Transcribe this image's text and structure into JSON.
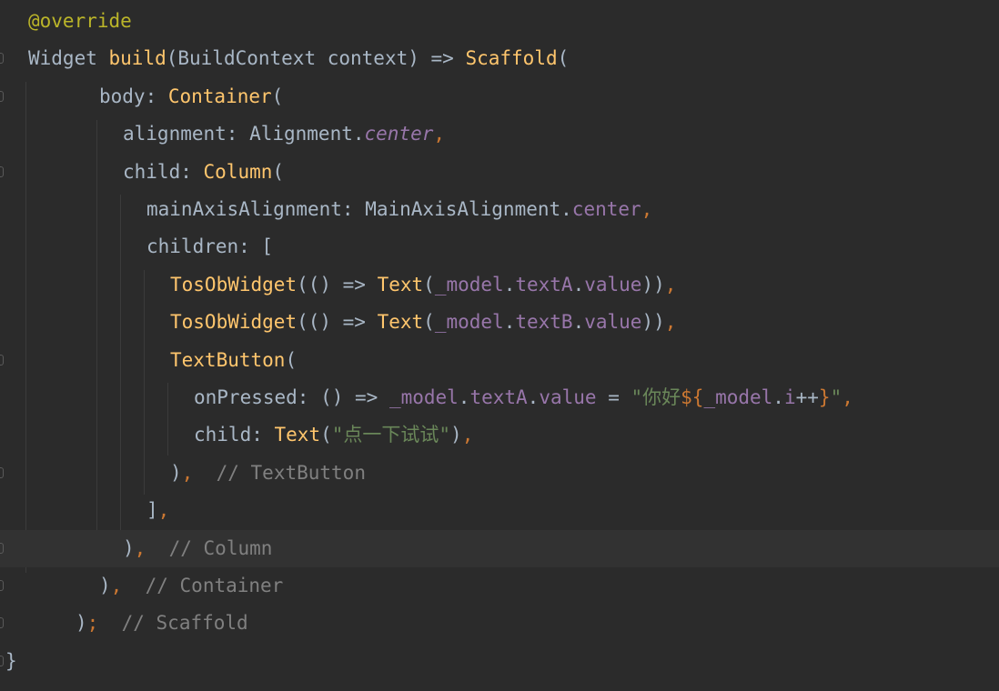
{
  "editor": {
    "language": "dart",
    "current_line": 14,
    "colors": {
      "background": "#2b2b2b",
      "current_line": "#323232",
      "annotation": "#bbb529",
      "plain": "#a9b7c6",
      "function": "#ffc66d",
      "keyword": "#cc7832",
      "field": "#9876aa",
      "string": "#6a8759",
      "comment": "#808080"
    },
    "lines": [
      {
        "fold": false,
        "tokens": [
          {
            "t": "@override",
            "c": "ann"
          }
        ]
      },
      {
        "fold": true,
        "tokens": [
          {
            "t": "Widget ",
            "c": "plain"
          },
          {
            "t": "build",
            "c": "fn"
          },
          {
            "t": "(BuildContext context) => ",
            "c": "plain"
          },
          {
            "t": "Scaffold",
            "c": "fn"
          },
          {
            "t": "(",
            "c": "plain"
          }
        ]
      },
      {
        "fold": true,
        "tokens": [
          {
            "t": "body: ",
            "c": "plain"
          },
          {
            "t": "Container",
            "c": "fn"
          },
          {
            "t": "(",
            "c": "plain"
          }
        ]
      },
      {
        "fold": false,
        "tokens": [
          {
            "t": "alignment: Alignment.",
            "c": "plain"
          },
          {
            "t": "center",
            "c": "static"
          },
          {
            "t": ",",
            "c": "kw"
          }
        ]
      },
      {
        "fold": true,
        "tokens": [
          {
            "t": "child: ",
            "c": "plain"
          },
          {
            "t": "Column",
            "c": "fn"
          },
          {
            "t": "(",
            "c": "plain"
          }
        ]
      },
      {
        "fold": false,
        "tokens": [
          {
            "t": "mainAxisAlignment: MainAxisAlignment.",
            "c": "plain"
          },
          {
            "t": "center",
            "c": "field"
          },
          {
            "t": ",",
            "c": "kw"
          }
        ]
      },
      {
        "fold": false,
        "tokens": [
          {
            "t": "children: [",
            "c": "plain"
          }
        ]
      },
      {
        "fold": false,
        "tokens": [
          {
            "t": "TosObWidget",
            "c": "fn"
          },
          {
            "t": "(() => ",
            "c": "plain"
          },
          {
            "t": "Text",
            "c": "fn"
          },
          {
            "t": "(",
            "c": "plain"
          },
          {
            "t": "_model",
            "c": "field"
          },
          {
            "t": ".",
            "c": "plain"
          },
          {
            "t": "textA",
            "c": "field"
          },
          {
            "t": ".",
            "c": "plain"
          },
          {
            "t": "value",
            "c": "field"
          },
          {
            "t": "))",
            "c": "plain"
          },
          {
            "t": ",",
            "c": "kw"
          }
        ]
      },
      {
        "fold": false,
        "tokens": [
          {
            "t": "TosObWidget",
            "c": "fn"
          },
          {
            "t": "(() => ",
            "c": "plain"
          },
          {
            "t": "Text",
            "c": "fn"
          },
          {
            "t": "(",
            "c": "plain"
          },
          {
            "t": "_model",
            "c": "field"
          },
          {
            "t": ".",
            "c": "plain"
          },
          {
            "t": "textB",
            "c": "field"
          },
          {
            "t": ".",
            "c": "plain"
          },
          {
            "t": "value",
            "c": "field"
          },
          {
            "t": "))",
            "c": "plain"
          },
          {
            "t": ",",
            "c": "kw"
          }
        ]
      },
      {
        "fold": true,
        "tokens": [
          {
            "t": "TextButton",
            "c": "fn"
          },
          {
            "t": "(",
            "c": "plain"
          }
        ]
      },
      {
        "fold": false,
        "tokens": [
          {
            "t": "onPressed: () => ",
            "c": "plain"
          },
          {
            "t": "_model",
            "c": "field"
          },
          {
            "t": ".",
            "c": "plain"
          },
          {
            "t": "textA",
            "c": "field"
          },
          {
            "t": ".",
            "c": "plain"
          },
          {
            "t": "value",
            "c": "field"
          },
          {
            "t": " = ",
            "c": "plain"
          },
          {
            "t": "\"你好",
            "c": "str"
          },
          {
            "t": "${",
            "c": "kw"
          },
          {
            "t": "_model",
            "c": "field"
          },
          {
            "t": ".",
            "c": "plain"
          },
          {
            "t": "i",
            "c": "field"
          },
          {
            "t": "++",
            "c": "plain"
          },
          {
            "t": "}",
            "c": "kw"
          },
          {
            "t": "\"",
            "c": "str"
          },
          {
            "t": ",",
            "c": "kw"
          }
        ]
      },
      {
        "fold": false,
        "tokens": [
          {
            "t": "child: ",
            "c": "plain"
          },
          {
            "t": "Text",
            "c": "fn"
          },
          {
            "t": "(",
            "c": "plain"
          },
          {
            "t": "\"点一下试试\"",
            "c": "str"
          },
          {
            "t": ")",
            "c": "plain"
          },
          {
            "t": ",",
            "c": "kw"
          }
        ]
      },
      {
        "fold": true,
        "tokens": [
          {
            "t": ")",
            "c": "plain"
          },
          {
            "t": ",",
            "c": "kw"
          },
          {
            "t": "  // TextButton",
            "c": "cmt"
          }
        ]
      },
      {
        "fold": false,
        "tokens": [
          {
            "t": "]",
            "c": "plain"
          },
          {
            "t": ",",
            "c": "kw"
          }
        ]
      },
      {
        "fold": true,
        "tokens": [
          {
            "t": ")",
            "c": "plain"
          },
          {
            "t": ",",
            "c": "kw"
          },
          {
            "t": "  // Column",
            "c": "cmt"
          }
        ]
      },
      {
        "fold": true,
        "tokens": [
          {
            "t": ")",
            "c": "plain"
          },
          {
            "t": ",",
            "c": "kw"
          },
          {
            "t": "  // Container",
            "c": "cmt"
          }
        ]
      },
      {
        "fold": true,
        "tokens": [
          {
            "t": ")",
            "c": "plain"
          },
          {
            "t": ";",
            "c": "kw"
          },
          {
            "t": "  // Scaffold",
            "c": "cmt"
          }
        ]
      },
      {
        "fold": true,
        "tokens": [
          {
            "t": "}",
            "c": "plain"
          }
        ]
      }
    ]
  }
}
